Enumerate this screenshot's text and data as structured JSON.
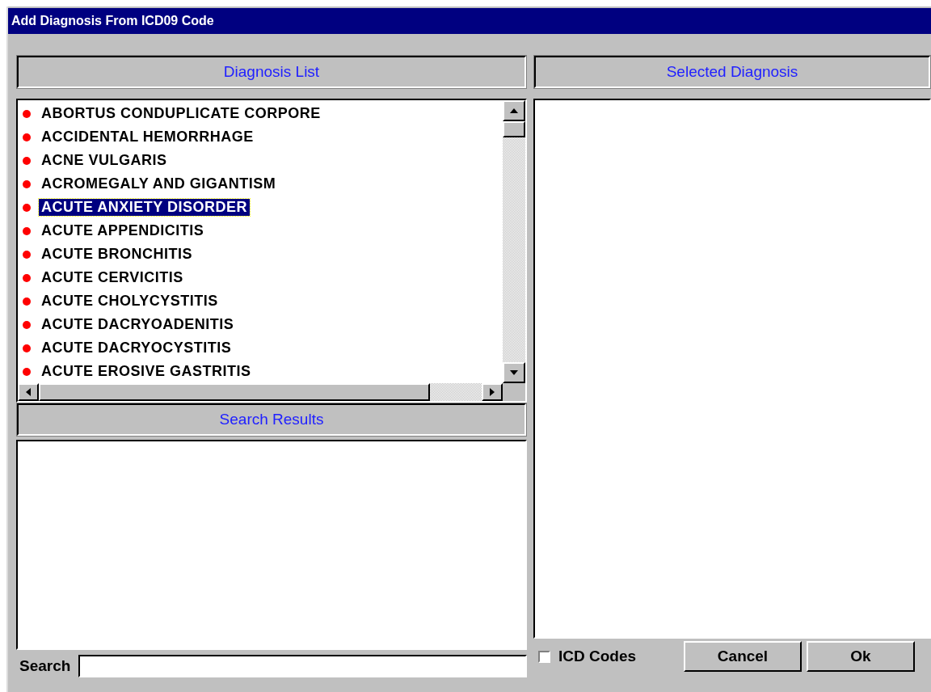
{
  "window": {
    "title": "Add Diagnosis From ICD09 Code"
  },
  "diagnosis_list": {
    "header": "Diagnosis List",
    "items": [
      {
        "label": "ABORTUS CONDUPLICATE CORPORE",
        "selected": false
      },
      {
        "label": "ACCIDENTAL HEMORRHAGE",
        "selected": false
      },
      {
        "label": "ACNE VULGARIS",
        "selected": false
      },
      {
        "label": "ACROMEGALY AND GIGANTISM",
        "selected": false
      },
      {
        "label": "ACUTE ANXIETY DISORDER",
        "selected": true
      },
      {
        "label": "ACUTE APPENDICITIS",
        "selected": false
      },
      {
        "label": "ACUTE BRONCHITIS",
        "selected": false
      },
      {
        "label": "ACUTE CERVICITIS",
        "selected": false
      },
      {
        "label": "ACUTE CHOLYCYSTITIS",
        "selected": false
      },
      {
        "label": "ACUTE DACRYOADENITIS",
        "selected": false
      },
      {
        "label": "ACUTE DACRYOCYSTITIS",
        "selected": false
      },
      {
        "label": "ACUTE EROSIVE GASTRITIS",
        "selected": false
      }
    ]
  },
  "search_results": {
    "header": "Search Results"
  },
  "selected_diagnosis": {
    "header": "Selected Diagnosis"
  },
  "search": {
    "label": "Search"
  },
  "icd_codes": {
    "label": "ICD Codes",
    "checked": false
  },
  "buttons": [
    "Cancel",
    "Ok"
  ]
}
